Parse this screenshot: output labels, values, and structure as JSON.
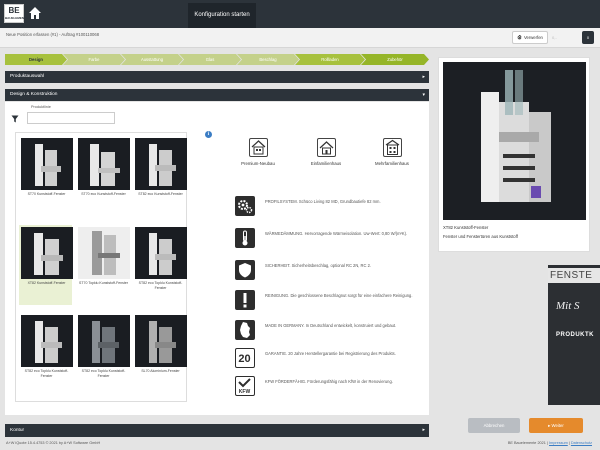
{
  "header": {
    "logo_text": "BE",
    "logo_sub": "BAUELEMENTE",
    "active_tab": "Konfiguration starten"
  },
  "subbar": {
    "position_text": "Neue Position erfassen (#1) - Auftrag #100110068",
    "discard_label": "Verwerfen",
    "mini_text": "0,-",
    "cart_count": "0"
  },
  "steps": [
    {
      "label": "Design",
      "state": "active"
    },
    {
      "label": "Farbe",
      "state": "done"
    },
    {
      "label": "Ausstattung",
      "state": "done"
    },
    {
      "label": "Glas",
      "state": "done"
    },
    {
      "label": "Beschlag",
      "state": "done"
    },
    {
      "label": "Rollladen",
      "state": "current"
    },
    {
      "label": "Zubehör",
      "state": "todo"
    }
  ],
  "panels": {
    "product_selection": "Produktauswahl",
    "design_construction": "Design & Konstruktion",
    "contour": "Kontur"
  },
  "filter": {
    "label": "Produktlinie",
    "value": ""
  },
  "products": [
    {
      "caption": "ST70 Kunststoff-Fenster",
      "selected": false
    },
    {
      "caption": "ST70 eco Kunststoff-Fenster",
      "selected": false
    },
    {
      "caption": "ST82 eco Kunststoff-Fenster",
      "selected": false
    },
    {
      "caption": "XT82 Kunststoff-Fenster",
      "selected": true
    },
    {
      "caption": "ST70 Topklu Kunststoff-Fenster",
      "selected": false
    },
    {
      "caption": "ST82 eco Topklu Kunststoff-Fenster",
      "selected": false
    },
    {
      "caption": "ST82 eco Topklu Kunststoff-Fenster",
      "selected": false
    },
    {
      "caption": "ST82 eco Topklu Kunststoff-Fenster",
      "selected": false
    },
    {
      "caption": "SL70 Aluminium-Fenster",
      "selected": false
    }
  ],
  "building_types": [
    {
      "label": "Premium-Neubau",
      "icon": "building-icon"
    },
    {
      "label": "Einfamilienhaus",
      "icon": "house-icon"
    },
    {
      "label": "Mehrfamilienhaus",
      "icon": "apartment-icon"
    }
  ],
  "features": [
    {
      "icon": "gears-icon",
      "text": "PROFILSYSTEM. Schüco Living 82 MD, Grundbautiefe 82 mm."
    },
    {
      "icon": "thermometer-icon",
      "text": "WÄRMEDÄMMUNG. Hervorragende Wärmeisolation. Uw-Wert: 0,80 W/(m²K)."
    },
    {
      "icon": "shield-icon",
      "text": "SICHERHEIT. Sicherheitsbeschlag, optional RC 2N, RC 2."
    },
    {
      "icon": "exclamation-icon",
      "text": "REINIGUNG. Die geschlossene Beschlagnut sorgt für eine einfachere Reinigung."
    },
    {
      "icon": "germany-map-icon",
      "text": "MADE IN GERMANY. In Deutschland entwickelt, konstruiert und gebaut."
    },
    {
      "icon": "twenty-years-icon",
      "text": "GARANTIE. 20 Jahre Herstellergarantie bei Registrierung des Produkts."
    },
    {
      "icon": "kfw-icon",
      "text": "KFW FÖRDERFÄHIG. Förderungsfähig nach KfW in der Renovierung."
    }
  ],
  "preview": {
    "title": "XT82 Kunststoff-Fenster",
    "subtitle": "Fenster und Fenstertüren aus Kunststoff"
  },
  "banner": {
    "line1": "FENSTE",
    "line2": "Mit S",
    "line3": "PRODUKTK"
  },
  "buttons": {
    "cancel": "Abbrechen",
    "next": "Weiter"
  },
  "footer": {
    "left": "A+W iQuote 15.4.4753 © 2021 by A+W Software GmbH",
    "right_text": "BE Bauelemente 2021 |",
    "imprint": "Impressum",
    "privacy": "Datenschutz"
  },
  "colors": {
    "dark": "#2c333a",
    "accent_green": "#a7c13d",
    "next_orange": "#e58a2c"
  }
}
